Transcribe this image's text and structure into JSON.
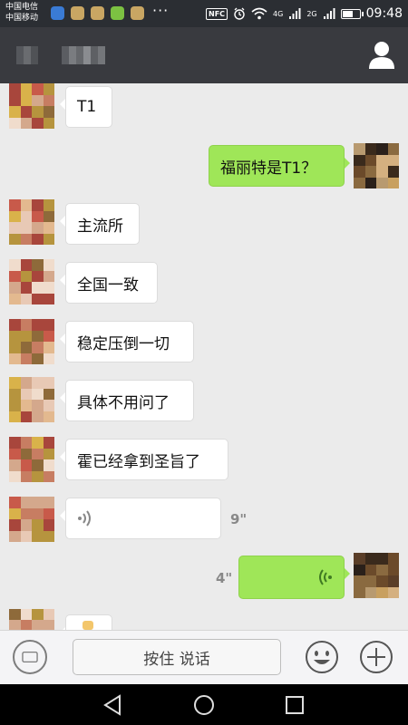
{
  "status_bar": {
    "carrier_1": "中国电信",
    "carrier_2": "中国移动",
    "more": "···",
    "nfc": "NFC",
    "net_1": "4G",
    "net_2": "2G",
    "time": "09:48",
    "battery_level": 0.65
  },
  "messages": [
    {
      "side": "in",
      "type": "text",
      "text": "T1"
    },
    {
      "side": "out",
      "type": "text",
      "text": "福丽特是T1？"
    },
    {
      "side": "in",
      "type": "text",
      "text": "主流所"
    },
    {
      "side": "in",
      "type": "text",
      "text": "全国一致"
    },
    {
      "side": "in",
      "type": "text",
      "text": "稳定压倒一切"
    },
    {
      "side": "in",
      "type": "text",
      "text": "具体不用问了"
    },
    {
      "side": "in",
      "type": "text",
      "text": "霍已经拿到圣旨了"
    },
    {
      "side": "in",
      "type": "voice",
      "duration": "9\""
    },
    {
      "side": "out",
      "type": "voice",
      "duration": "4\""
    }
  ],
  "input_bar": {
    "hold_to_talk": "按住 说话",
    "voice_toggle_icon": "keyboard-voice-icon",
    "emoji_icon": "smiley-icon",
    "plus_icon": "plus-circle-icon"
  },
  "title_bar": {
    "profile_icon": "person-icon"
  },
  "nav_bar": {
    "back_icon": "triangle-back-icon",
    "home_icon": "circle-home-icon",
    "recents_icon": "square-recents-icon"
  }
}
